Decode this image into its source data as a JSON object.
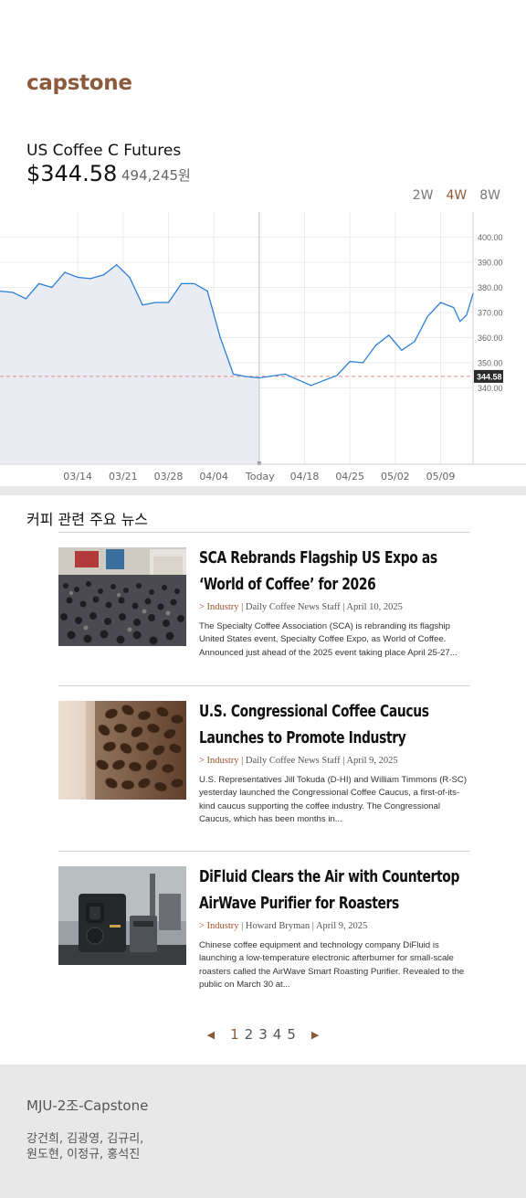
{
  "brand": "capstone",
  "quote": {
    "name": "US Coffee C Futures",
    "price": "$344.58",
    "price_krw": "494,245원"
  },
  "range_tabs": [
    {
      "label": "2W",
      "active": false
    },
    {
      "label": "4W",
      "active": true
    },
    {
      "label": "8W",
      "active": false
    }
  ],
  "chart_data": {
    "type": "area",
    "title": "",
    "xlabel": "",
    "ylabel": "",
    "categories": [
      "03/14",
      "03/21",
      "03/28",
      "04/04",
      "Today",
      "04/18",
      "04/25",
      "05/02",
      "05/09"
    ],
    "y_ticks": [
      340,
      350,
      360,
      370,
      380,
      390,
      400
    ],
    "y_tick_labels": [
      "340.00",
      "350.00",
      "360.00",
      "370.00",
      "380.00",
      "390.00",
      "400.00"
    ],
    "ylim": [
      310,
      410
    ],
    "current_value": 344.58,
    "current_label": "344.58",
    "grid": true,
    "x_range_days": [
      -40,
      33
    ],
    "series": [
      {
        "x": [
          -40,
          -38,
          -36,
          -34,
          -32,
          -30,
          -28,
          -26,
          -24,
          -22,
          -20,
          -18,
          -16,
          -14,
          -12,
          -10,
          -8,
          -6,
          -4,
          -2,
          0,
          4,
          8,
          10,
          12,
          14,
          16,
          18,
          20,
          22,
          24,
          26,
          28,
          30,
          31,
          32,
          33
        ],
        "y": [
          378.5,
          378,
          375.5,
          381.5,
          380,
          386,
          384,
          383.5,
          385,
          389,
          384,
          373,
          374,
          374,
          381.5,
          381.5,
          378.5,
          360,
          345.5,
          344.5,
          344,
          345.5,
          341,
          343,
          345,
          350.5,
          350,
          357,
          361,
          355,
          358.5,
          368.5,
          374,
          372,
          366.5,
          369,
          377.5
        ]
      }
    ],
    "colors": {
      "line": "#2b7fd6",
      "fill": "#e9edf3",
      "current_line": "#e08a8a"
    }
  },
  "news": {
    "heading": "커피 관련 주요 뉴스",
    "items": [
      {
        "title": "SCA Rebrands Flagship US Expo as ‘World of Coffee’ for 2026",
        "category": "> Industry",
        "meta": " | Daily Coffee News Staff | April 10, 2025",
        "excerpt": "The Specialty Coffee Association (SCA) is rebranding its flagship United States event, Specialty Coffee Expo, as World of Coffee. Announced just ahead of the 2025 event taking place April 25-27...",
        "image": "expo-crowd"
      },
      {
        "title": "U.S. Congressional Coffee Caucus Launches to Promote Industry",
        "category": "> Industry",
        "meta": " | Daily Coffee News Staff | April 9, 2025",
        "excerpt": "U.S. Representatives Jill Tokuda (D-HI) and William Timmons (R-SC) yesterday launched the Congressional Coffee Caucus, a first-of-its-kind caucus supporting the coffee industry. The Congressional Caucus, which has been months in...",
        "image": "coffee-beans"
      },
      {
        "title": "DiFluid Clears the Air with Countertop AirWave Purifier for Roasters",
        "category": "> Industry",
        "meta": " | Howard Bryman | April 9, 2025",
        "excerpt": "Chinese coffee equipment and technology company DiFluid is launching a low-temperature electronic afterburner for small-scale roasters called the AirWave Smart Roasting Purifier. Revealed to the public on March 30 at...",
        "image": "roaster-device"
      }
    ]
  },
  "pagination": {
    "prev": "◀",
    "next": "▶",
    "pages": [
      {
        "label": "1",
        "active": true
      },
      {
        "label": "2",
        "active": false
      },
      {
        "label": "3",
        "active": false
      },
      {
        "label": "4",
        "active": false
      },
      {
        "label": "5",
        "active": false
      }
    ]
  },
  "footer": {
    "title": "MJU-2조-Capstone",
    "members_line1": "강건희, 김광영, 김규리,",
    "members_line2": "원도현, 이정규, 홍석진"
  }
}
